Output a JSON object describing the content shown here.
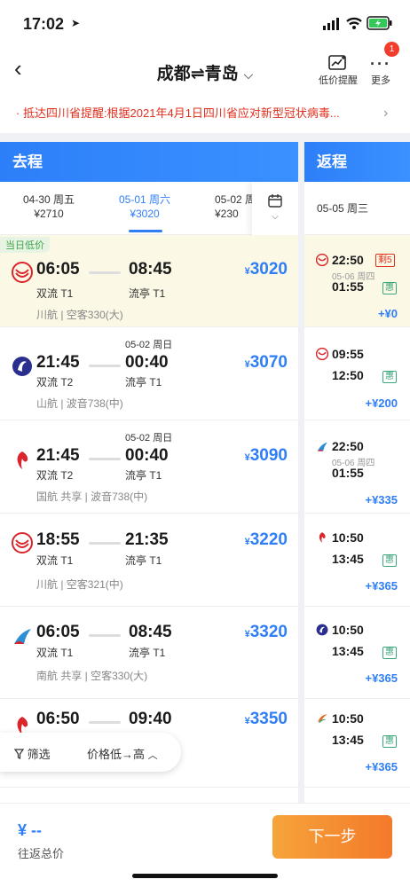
{
  "status": {
    "time": "17:02"
  },
  "nav": {
    "title": "成都⇌青岛",
    "price_alert": "低价提醒",
    "more": "更多",
    "badge": "1"
  },
  "notice": {
    "text": "· 抵达四川省提醒:根据2021年4月1日四川省应对新型冠状病毒..."
  },
  "outbound": {
    "header": "去程",
    "dates": [
      {
        "date": "04-30 周五",
        "price": "¥2710"
      },
      {
        "date": "05-01 周六",
        "price": "¥3020"
      },
      {
        "date": "05-02 周",
        "price": "¥230"
      }
    ],
    "lowest_tag": "当日低价",
    "flights": [
      {
        "dep": "06:05",
        "arr": "08:45",
        "dep_apt": "双流 T1",
        "arr_apt": "流亭 T1",
        "meta": "川航 | 空客330(大)",
        "price": "3020",
        "nextday": ""
      },
      {
        "dep": "21:45",
        "arr": "00:40",
        "dep_apt": "双流 T2",
        "arr_apt": "流亭 T1",
        "meta": "山航 | 波音738(中)",
        "price": "3070",
        "nextday": "05-02 周日"
      },
      {
        "dep": "21:45",
        "arr": "00:40",
        "dep_apt": "双流 T2",
        "arr_apt": "流亭 T1",
        "meta": "国航 共享 | 波音738(中)",
        "price": "3090",
        "nextday": "05-02 周日"
      },
      {
        "dep": "18:55",
        "arr": "21:35",
        "dep_apt": "双流 T1",
        "arr_apt": "流亭 T1",
        "meta": "川航 | 空客321(中)",
        "price": "3220",
        "nextday": ""
      },
      {
        "dep": "06:05",
        "arr": "08:45",
        "dep_apt": "双流 T1",
        "arr_apt": "流亭 T1",
        "meta": "南航 共享 | 空客330(大)",
        "price": "3320",
        "nextday": ""
      },
      {
        "dep": "06:50",
        "arr": "09:40",
        "dep_apt": "",
        "arr_apt": "",
        "meta": "",
        "price": "3350",
        "nextday": ""
      }
    ]
  },
  "return": {
    "header": "返程",
    "date": "05-05 周三",
    "flights": [
      {
        "dep": "22:50",
        "arr": "01:55",
        "sub": "05-06 周四",
        "tag": "剩5",
        "hui": "惠",
        "plus": "+¥0"
      },
      {
        "dep": "09:55",
        "arr": "12:50",
        "sub": "",
        "tag": "",
        "hui": "惠",
        "plus": "+¥200"
      },
      {
        "dep": "22:50",
        "arr": "01:55",
        "sub": "05-06 周四",
        "tag": "",
        "hui": "",
        "plus": "+¥335"
      },
      {
        "dep": "10:50",
        "arr": "13:45",
        "sub": "",
        "tag": "",
        "hui": "惠",
        "plus": "+¥365"
      },
      {
        "dep": "10:50",
        "arr": "13:45",
        "sub": "",
        "tag": "",
        "hui": "惠",
        "plus": "+¥365"
      },
      {
        "dep": "10:50",
        "arr": "13:45",
        "sub": "",
        "tag": "",
        "hui": "惠",
        "plus": "+¥365"
      }
    ]
  },
  "filter": {
    "filter_label": "筛选",
    "sort_label": "价格低→高"
  },
  "bottom": {
    "price": "¥ --",
    "price_label": "往返总价",
    "next": "下一步"
  }
}
